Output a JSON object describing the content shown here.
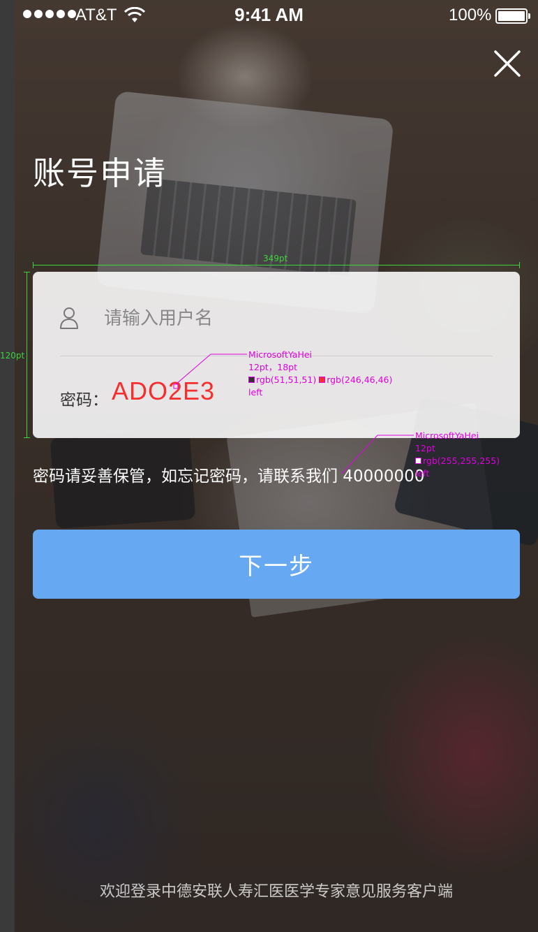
{
  "status_bar": {
    "carrier": "AT&T",
    "time": "9:41 AM",
    "battery": "100%"
  },
  "page": {
    "title": "账号申请"
  },
  "form": {
    "username_placeholder": "请输入用户名",
    "password_label": "密码：",
    "password_value": "ADO2E3"
  },
  "hint_text": "密码请妥善保管，如忘记密码，请联系我们 40000000",
  "next_button_label": "下一步",
  "footer_text": "欢迎登录中德安联人寿汇医医学专家意见服务客户端",
  "annotations": {
    "width_label": "349pt",
    "height_label": "120pt",
    "spec_password": {
      "font": "MicrosoftYaHei",
      "size": "12pt，18pt",
      "color1": "rgb(51,51,51)",
      "color2": "rgb(246,46,46)",
      "align": "left"
    },
    "spec_hint": {
      "font": "MicrosoftYaHei",
      "size": "12pt",
      "color1": "rgb(255,255,255)",
      "align": "left"
    }
  },
  "colors": {
    "button": "#66a9f2",
    "password_red": "#f62e2e",
    "label_gray": "#333333",
    "annotation_magenta": "#e000e0",
    "annotation_green": "#3ed43e"
  },
  "icons": {
    "close": "close-icon",
    "user": "user-icon",
    "wifi": "wifi-icon",
    "battery": "battery-icon",
    "signal": "signal-dots-icon"
  }
}
